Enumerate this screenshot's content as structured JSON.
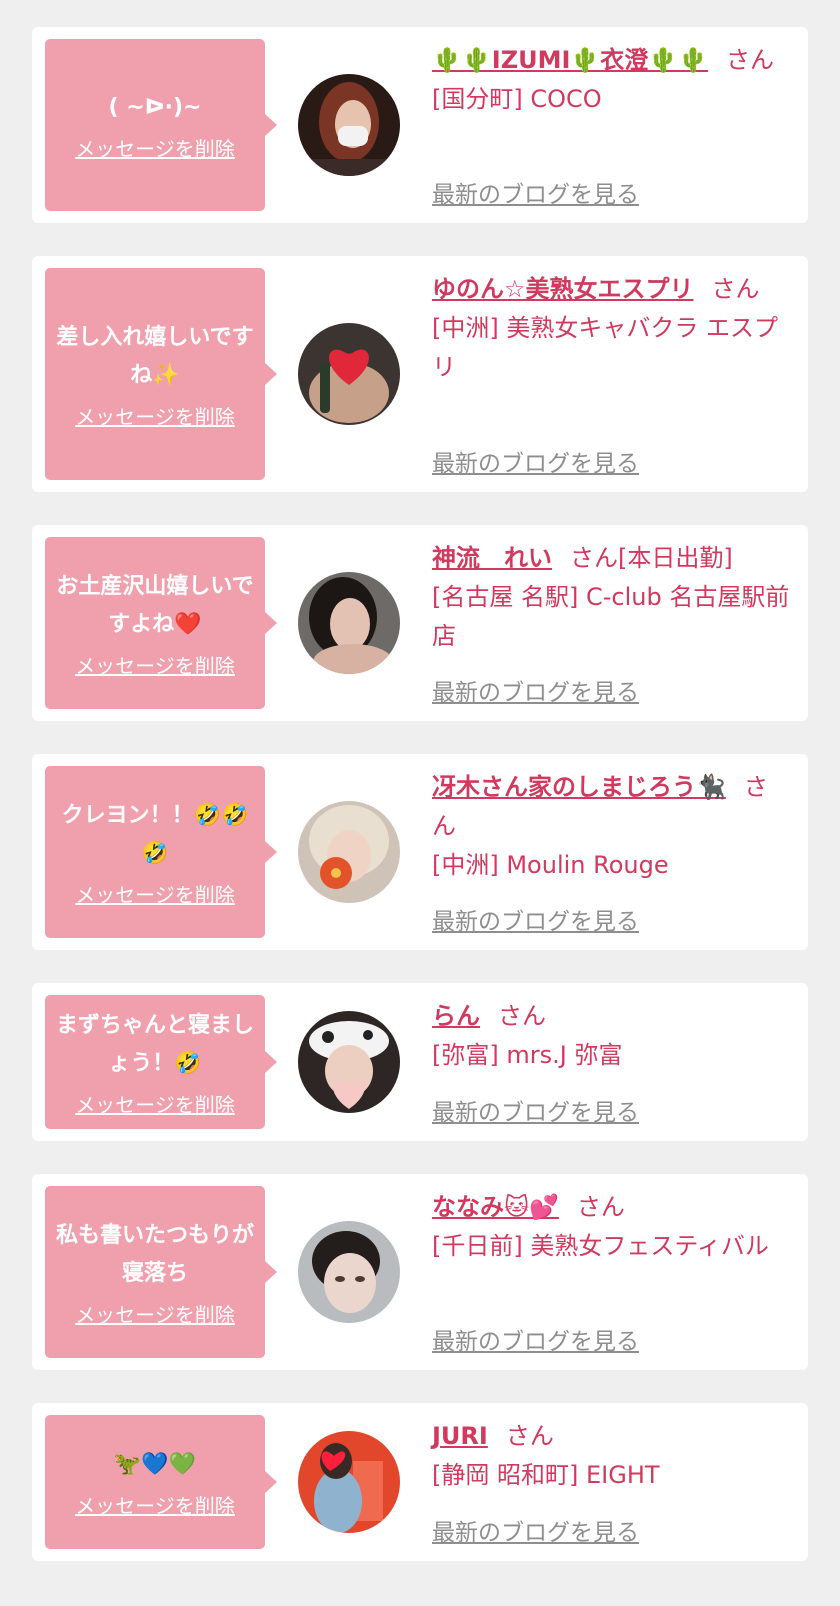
{
  "delete_label": "メッセージを削除",
  "blog_label": "最新のブログを見る",
  "san_label": "さん",
  "colors": {
    "accent": "#d1395f",
    "bubble": "#f0a0ad",
    "link_gray": "#8e8e8e"
  },
  "messages": [
    {
      "message": "( ~ᐅ·)~",
      "name": "🌵🌵IZUMI🌵衣澄🌵🌵",
      "suffix": "",
      "shop": "[国分町] COCO"
    },
    {
      "message": "差し入れ嬉しいですね✨",
      "name": "ゆのん☆美熟女エスプリ",
      "suffix": "",
      "shop": "[中洲] 美熟女キャバクラ エスプリ"
    },
    {
      "message": "お土産沢山嬉しいですよね❤️",
      "name": "神流　れい",
      "suffix": "[本日出勤]",
      "shop": "[名古屋 名駅] C-club 名古屋駅前店"
    },
    {
      "message": "クレヨン！！🤣🤣🤣",
      "name": "冴木さん家のしまじろう🐈‍⬛",
      "suffix": "",
      "shop": "[中洲] Moulin Rouge"
    },
    {
      "message": "まずちゃんと寝ましょう！🤣",
      "name": "らん",
      "suffix": "",
      "shop": "[弥富] mrs.J 弥富"
    },
    {
      "message": "私も書いたつもりが寝落ち",
      "name": "ななみ🐱💕",
      "suffix": "",
      "shop": "[千日前] 美熟女フェスティバル"
    },
    {
      "message": "🦖💙💚",
      "name": "JURI",
      "suffix": "",
      "shop": "[静岡 昭和町] EIGHT"
    }
  ]
}
